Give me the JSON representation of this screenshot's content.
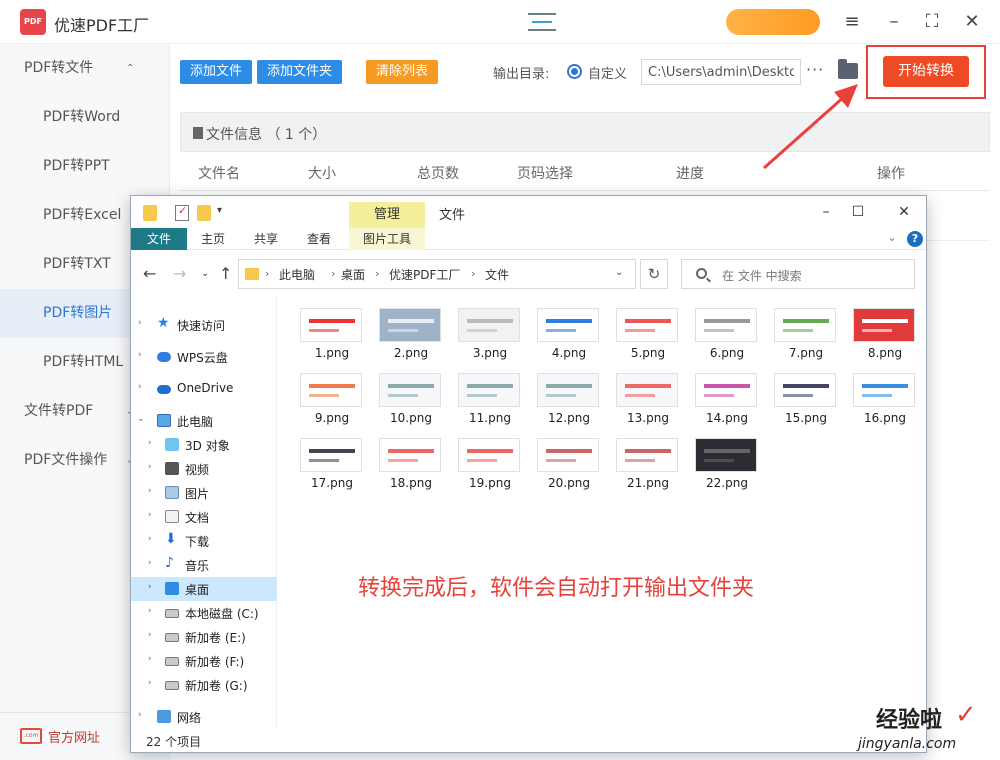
{
  "app": {
    "logo_text": "PDF",
    "title": "优速PDF工厂",
    "win_controls": [
      "≡",
      "–",
      "⛶",
      "✕"
    ]
  },
  "sidebar": {
    "items": [
      {
        "label": "PDF转文件",
        "arrow": "⌃"
      },
      {
        "label": "PDF转Word"
      },
      {
        "label": "PDF转PPT"
      },
      {
        "label": "PDF转Excel"
      },
      {
        "label": "PDF转TXT"
      },
      {
        "label": "PDF转图片"
      },
      {
        "label": "PDF转HTML"
      },
      {
        "label": "文件转PDF",
        "arrow": "⌄"
      },
      {
        "label": "PDF文件操作",
        "arrow": "⌄"
      }
    ],
    "footer_label": "官方网址",
    "footer_icon_text": ".com"
  },
  "toolbar": {
    "add_file": "添加文件",
    "add_folder": "添加文件夹",
    "clear_list": "清除列表",
    "output_label": "输出目录:",
    "radio_label": "自定义",
    "path_value": "C:\\Users\\admin\\Desktop",
    "more": "···",
    "start": "开始转换"
  },
  "file_panel": {
    "title": "文件信息 （ 1 个）",
    "columns": [
      "文件名",
      "大小",
      "总页数",
      "页码选择",
      "进度",
      "操作"
    ]
  },
  "explorer": {
    "title": "文件",
    "manage_tab": "管理",
    "ribbon_tabs": [
      "文件",
      "主页",
      "共享",
      "查看",
      "图片工具"
    ],
    "help": "?",
    "breadcrumb": [
      "此电脑",
      "桌面",
      "优速PDF工厂",
      "文件"
    ],
    "search_placeholder": "在 文件 中搜索",
    "nav": [
      {
        "label": "快速访问"
      },
      {
        "label": "WPS云盘"
      },
      {
        "label": "OneDrive"
      },
      {
        "label": "此电脑"
      },
      {
        "label": "3D 对象"
      },
      {
        "label": "视频"
      },
      {
        "label": "图片"
      },
      {
        "label": "文档"
      },
      {
        "label": "下载"
      },
      {
        "label": "音乐"
      },
      {
        "label": "桌面"
      },
      {
        "label": "本地磁盘 (C:)"
      },
      {
        "label": "新加卷 (E:)"
      },
      {
        "label": "新加卷 (F:)"
      },
      {
        "label": "新加卷 (G:)"
      },
      {
        "label": "网络"
      }
    ],
    "status": "22 个项目",
    "files": [
      "1.png",
      "2.png",
      "3.png",
      "4.png",
      "5.png",
      "6.png",
      "7.png",
      "8.png",
      "9.png",
      "10.png",
      "11.png",
      "12.png",
      "13.png",
      "14.png",
      "15.png",
      "16.png",
      "17.png",
      "18.png",
      "19.png",
      "20.png",
      "21.png",
      "22.png"
    ]
  },
  "annotation": "转换完成后，软件会自动打开输出文件夹",
  "watermark": {
    "text": "经验啦",
    "url": "jingyanla.com"
  },
  "colors": {
    "accent_blue": "#2d8ce6",
    "accent_orange": "#f59a23",
    "start_red": "#ee4a25",
    "annotation_red": "#e8403a"
  }
}
